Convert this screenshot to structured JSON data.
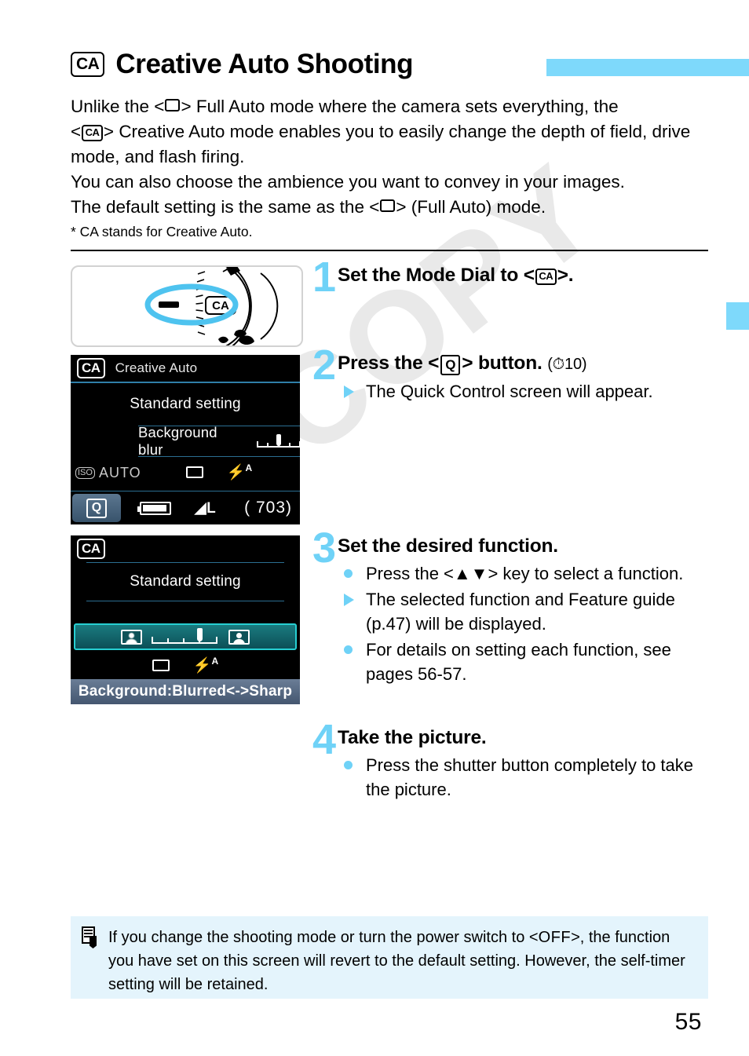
{
  "header": {
    "badge": "CA",
    "title": "Creative Auto Shooting"
  },
  "intro": {
    "line1_a": "Unlike the <",
    "line1_b": "> Full Auto mode where the camera sets everything, the",
    "line2_a": "<",
    "line2_b": "> Creative Auto mode enables you to easily change the depth of field, drive mode, and flash firing.",
    "line3": "You can also choose the ambience you want to convey in your images.",
    "line4_a": "The default setting is the same as the <",
    "line4_b": "> (Full Auto) mode.",
    "footnote": "* CA stands for Creative Auto."
  },
  "figures": {
    "dial": {
      "label": "CA",
      "caption": "mode-dial-set-to-CA"
    },
    "lcd1": {
      "badge": "CA",
      "mode_name": "Creative Auto",
      "ambience": "Standard setting",
      "blur_label": "Background blur",
      "iso": "AUTO",
      "iso_tag": "ISO",
      "q_label": "Q",
      "quality": "L",
      "shots": "( 703)"
    },
    "lcd2": {
      "badge": "CA",
      "ambience": "Standard setting",
      "guide": "Background:Blurred<->Sharp"
    }
  },
  "steps": [
    {
      "num": "1",
      "title_a": "Set the Mode Dial to <",
      "title_badge": "CA",
      "title_b": ">.",
      "bullets": []
    },
    {
      "num": "2",
      "title_a": "Press the <",
      "title_badge": "Q",
      "title_b": "> button.",
      "suffix": "(⏱10)",
      "bullets": [
        {
          "marker": "tri",
          "text": "The Quick Control screen will appear."
        }
      ]
    },
    {
      "num": "3",
      "title": "Set the desired function.",
      "bullets": [
        {
          "marker": "dot",
          "text_a": "Press the <",
          "key": "▲▼",
          "text_b": "> key to select a function."
        },
        {
          "marker": "tri",
          "text": "The selected function and Feature guide (p.47) will be displayed."
        },
        {
          "marker": "dot",
          "text": "For details on setting each function, see pages 56-57."
        }
      ]
    },
    {
      "num": "4",
      "title": "Take the picture.",
      "bullets": [
        {
          "marker": "dot",
          "text": "Press the shutter button completely to take the picture."
        }
      ]
    }
  ],
  "note": {
    "text_a": "If you change the shooting mode or turn the power switch to <",
    "off": "OFF",
    "text_b": ">, the function you have set on this screen will revert to the default setting. However, the self-timer setting will be retained."
  },
  "page_number": "55",
  "watermark": "COPY",
  "colors": {
    "accent": "#7ed9fb",
    "step_num": "#6fd2f7",
    "note_bg": "#e4f4fc",
    "lcd_sel": "#27cfd2"
  }
}
